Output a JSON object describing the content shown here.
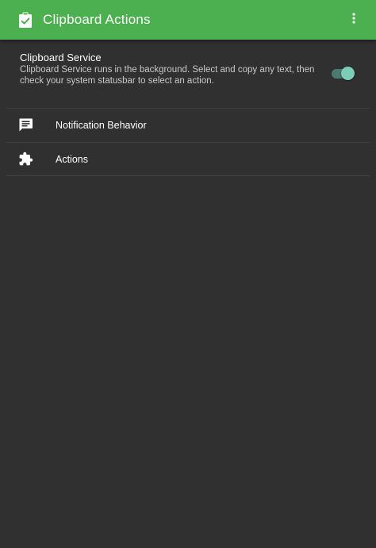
{
  "appbar": {
    "title": "Clipboard Actions",
    "icon": "clipboard-check-icon",
    "overflow_icon": "more-vert-icon",
    "color": "#4caf50"
  },
  "service": {
    "title": "Clipboard Service",
    "description": "Clipboard Service runs in the background. Select and copy any text, then check your system statusbar to select an action.",
    "toggle_on": true,
    "toggle_color": "#7ccdb8"
  },
  "menu": {
    "items": [
      {
        "label": "Notification Behavior",
        "icon": "message-icon"
      },
      {
        "label": "Actions",
        "icon": "puzzle-icon"
      }
    ]
  },
  "colors": {
    "background": "#303030",
    "divider": "#3e3e3e"
  }
}
